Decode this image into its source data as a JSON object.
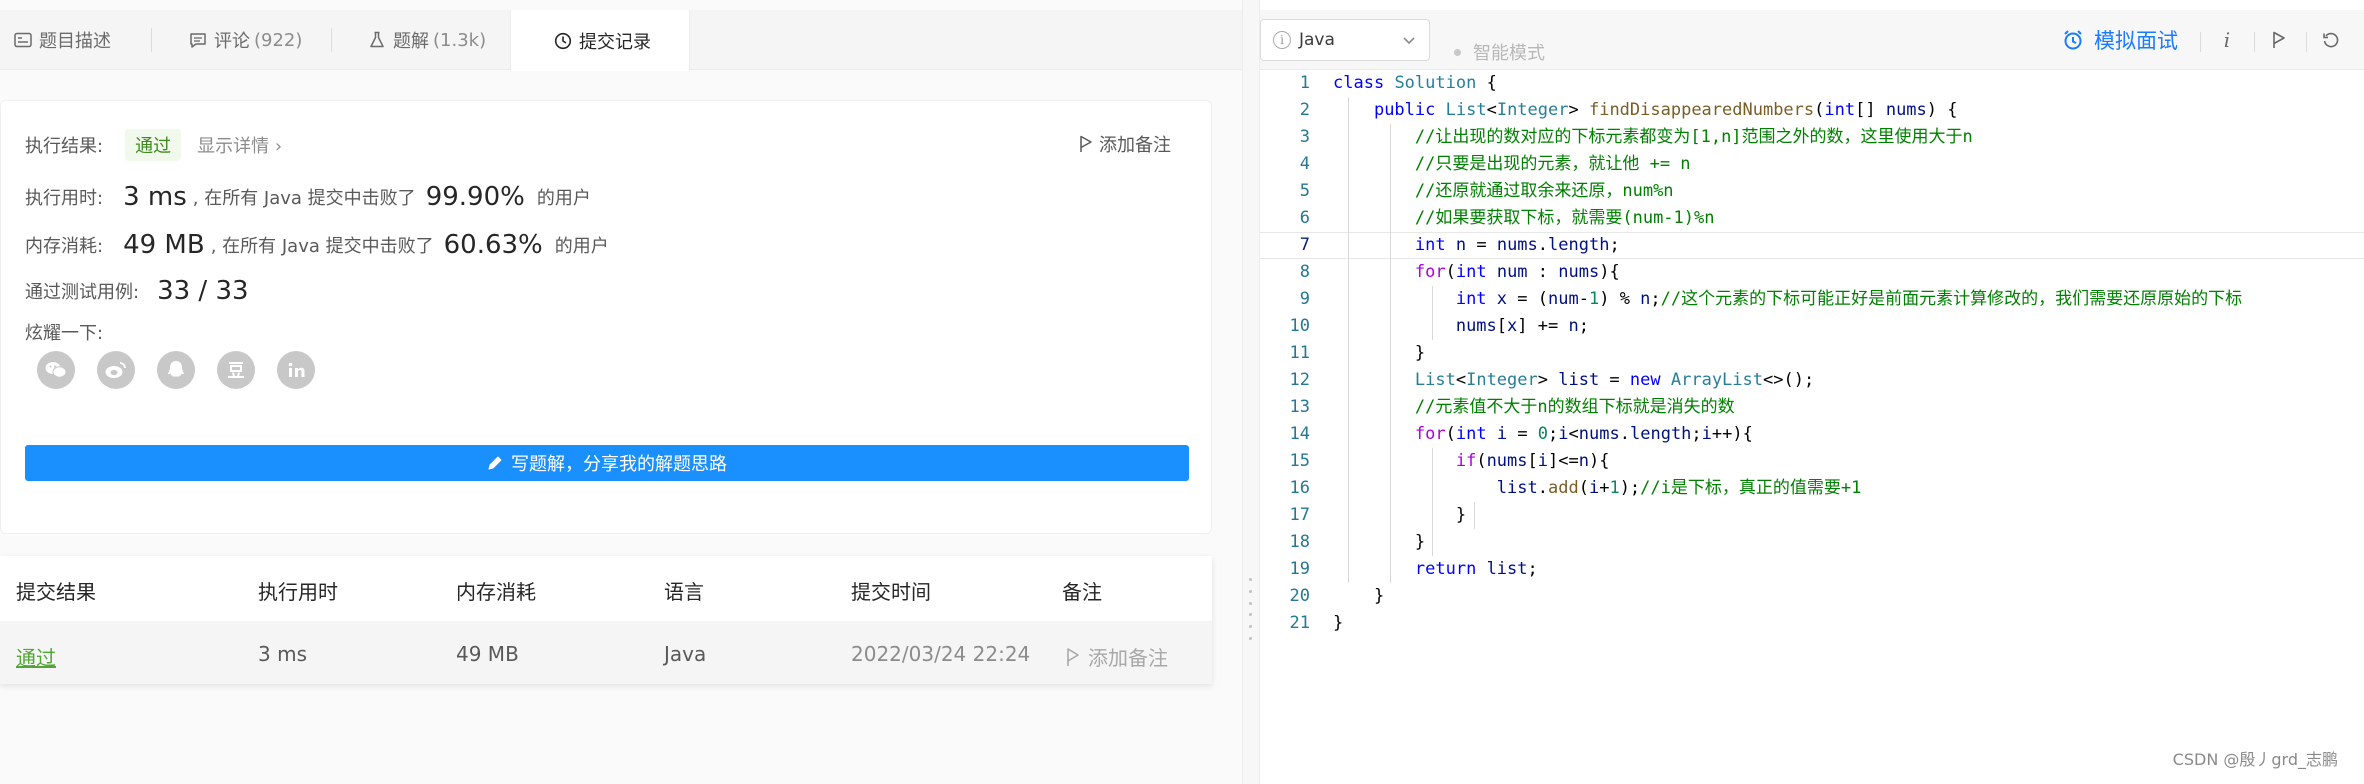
{
  "tabs": [
    {
      "label": "题目描述",
      "count": "",
      "icon": "description-icon"
    },
    {
      "label": "评论",
      "count": "(922)",
      "icon": "comment-icon"
    },
    {
      "label": "题解",
      "count": "(1.3k)",
      "icon": "flask-icon"
    },
    {
      "label": "提交记录",
      "count": "",
      "icon": "clock-icon"
    }
  ],
  "result": {
    "status_label": "执行结果:",
    "status_value": "通过",
    "show_detail": "显示详情",
    "add_note": "添加备注",
    "time_label": "执行用时:",
    "time_value": "3 ms",
    "time_desc": ", 在所有 Java 提交中击败了",
    "time_percent": "99.90%",
    "time_suffix": "的用户",
    "mem_label": "内存消耗:",
    "mem_value": "49 MB",
    "mem_desc": ", 在所有 Java 提交中击败了",
    "mem_percent": "60.63%",
    "mem_suffix": "的用户",
    "tests_label": "通过测试用例:",
    "tests_value": "33 / 33",
    "share_label": "炫耀一下:",
    "share_icons": [
      "wechat-icon",
      "weibo-icon",
      "qq-icon",
      "douban-icon",
      "linkedin-icon"
    ],
    "write_button": "写题解，分享我的解题思路"
  },
  "submissions": {
    "headers": [
      "提交结果",
      "执行用时",
      "内存消耗",
      "语言",
      "提交时间",
      "备注"
    ],
    "rows": [
      {
        "result": "通过",
        "time": "3 ms",
        "memory": "49 MB",
        "lang": "Java",
        "date": "2022/03/24 22:24",
        "note": "添加备注"
      }
    ]
  },
  "editor": {
    "language": "Java",
    "smart_mode": "智能模式",
    "mock_interview": "模拟面试",
    "current_line": 7
  },
  "code_lines": [
    "class Solution {",
    "    public List<Integer> findDisappearedNumbers(int[] nums) {",
    "        //让出现的数对应的下标元素都变为[1,n]范围之外的数，这里使用大于n",
    "        //只要是出现的元素，就让他 += n",
    "        //还原就通过取余来还原，num%n",
    "        //如果要获取下标，就需要(num-1)%n",
    "        int n = nums.length;",
    "        for(int num : nums){",
    "            int x = (num-1) % n;//这个元素的下标可能正好是前面元素计算修改的，我们需要还原原始的下标",
    "            nums[x] += n;",
    "        }",
    "        List<Integer> list = new ArrayList<>();",
    "        //元素值不大于n的数组下标就是消失的数",
    "        for(int i = 0;i<nums.length;i++){",
    "            if(nums[i]<=n){",
    "                list.add(i+1);//i是下标，真正的值需要+1",
    "            }",
    "        }",
    "        return list;",
    "    }",
    "}"
  ],
  "watermark": "CSDN @殷丿grd_志鹏",
  "colors": {
    "accent": "#1a90ff",
    "pass": "#52a536",
    "mock": "#1a7cff"
  }
}
